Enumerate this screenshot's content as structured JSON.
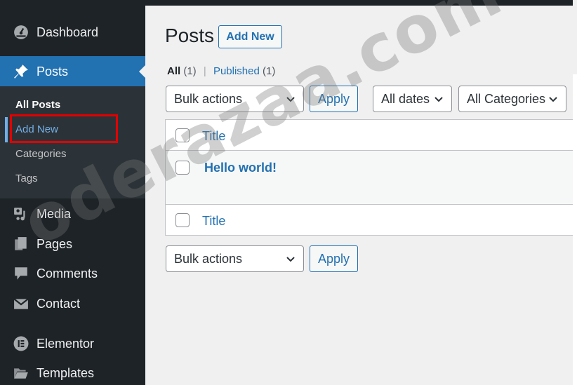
{
  "sidebar": {
    "items": [
      {
        "label": "Dashboard",
        "icon": "dashboard-icon"
      },
      {
        "label": "Posts",
        "icon": "pin-icon",
        "active": true
      },
      {
        "label": "Media",
        "icon": "media-icon"
      },
      {
        "label": "Pages",
        "icon": "pages-icon"
      },
      {
        "label": "Comments",
        "icon": "comment-icon"
      },
      {
        "label": "Contact",
        "icon": "mail-icon"
      },
      {
        "label": "Elementor",
        "icon": "elementor-icon"
      },
      {
        "label": "Templates",
        "icon": "folder-icon"
      }
    ],
    "submenu": [
      "All Posts",
      "Add New",
      "Categories",
      "Tags"
    ]
  },
  "main": {
    "title": "Posts",
    "add_new": "Add New",
    "filters": {
      "all": "All",
      "all_count": "(1)",
      "published": "Published",
      "published_count": "(1)"
    },
    "bulk_actions": "Bulk actions",
    "apply": "Apply",
    "dates": "All dates",
    "categories": "All Categories",
    "table": {
      "column_title": "Title",
      "rows": [
        {
          "title": "Hello world!"
        }
      ]
    }
  },
  "watermark": "oderazaa.com",
  "colors": {
    "accent": "#2271b1",
    "sidebar_bg": "#1d2327",
    "submenu_bg": "#2c3338",
    "highlight_box": "#e10000"
  }
}
